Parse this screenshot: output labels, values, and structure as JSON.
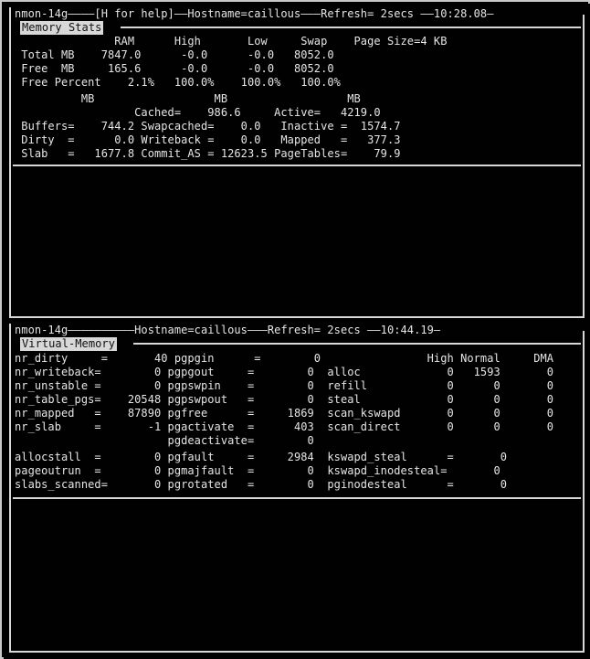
{
  "terminal": {
    "background_color": "#000000",
    "foreground_color": "#e6e6e6",
    "border_color": "#d8d8d8",
    "inverse_text_color": "#101010"
  },
  "panels": [
    {
      "id": "memory-stats",
      "titlebar": "nmon-14g————[H for help]——Hostname=caillous———Refresh= 2secs ——10:28.08—",
      "app_name": "nmon-14g",
      "help_hint": "[H for help]",
      "hostname_label": "Hostname=caillous",
      "refresh_label": "Refresh= 2secs",
      "clock": "10:28.08",
      "section_label": "Memory Stats",
      "lines": [
        "               RAM      High       Low     Swap    Page Size=4 KB",
        " Total MB    7847.0      -0.0      -0.0   8052.0",
        " Free  MB     165.6      -0.0      -0.0   8052.0",
        " Free Percent    2.1%   100.0%    100.0%   100.0%",
        "          MB                  MB                  MB",
        "                  Cached=    986.6     Active=   4219.0",
        " Buffers=    744.2 Swapcached=    0.0   Inactive =  1574.7",
        " Dirty  =      0.0 Writeback =    0.0   Mapped   =   377.3",
        " Slab   =   1677.8 Commit_AS = 12623.5 PageTables=    79.9"
      ]
    },
    {
      "id": "virtual-memory",
      "titlebar": "nmon-14g——————————Hostname=caillous———Refresh= 2secs ——10:44.19—",
      "app_name": "nmon-14g",
      "hostname_label": "Hostname=caillous",
      "refresh_label": "Refresh= 2secs",
      "clock": "10:44.19",
      "section_label": "Virtual-Memory",
      "lines": [
        "nr_dirty     =       40 pgpgin      =        0                High Normal     DMA",
        "nr_writeback=        0 pgpgout     =        0  alloc             0   1593       0",
        "nr_unstable =        0 pgpswpin    =        0  refill            0      0       0",
        "nr_table_pgs=    20548 pgpswpout   =        0  steal             0      0       0",
        "nr_mapped   =    87890 pgfree      =     1869  scan_kswapd       0      0       0",
        "nr_slab     =       -1 pgactivate  =      403  scan_direct       0      0       0",
        "                       pgdeactivate=        0",
        "allocstall  =        0 pgfault     =     2984  kswapd_steal      =       0",
        "pageoutrun  =        0 pgmajfault  =        0  kswapd_inodesteal=       0",
        "slabs_scanned=       0 pgrotated   =        0  pginodesteal      =       0"
      ]
    }
  ]
}
